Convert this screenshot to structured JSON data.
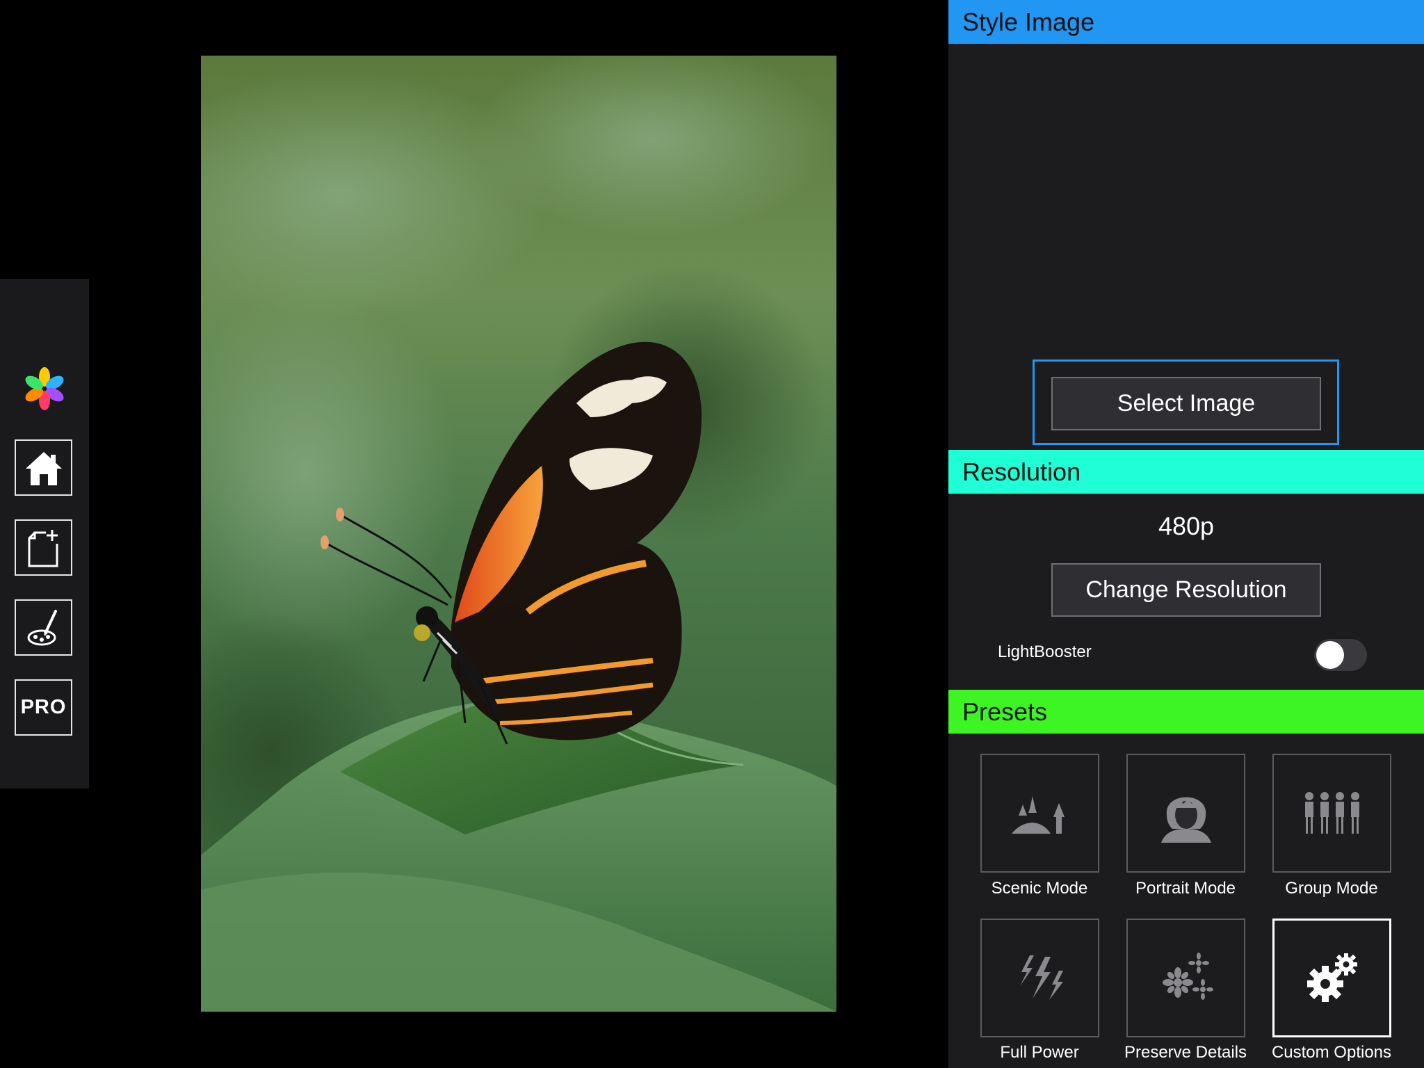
{
  "toolbar": {
    "items": [
      {
        "name": "app-logo-icon"
      },
      {
        "name": "home-icon"
      },
      {
        "name": "new-document-icon"
      },
      {
        "name": "paint-brush-icon"
      },
      {
        "name": "pro-badge",
        "label": "PRO"
      }
    ]
  },
  "photo": {
    "subject": "butterfly-on-leaf"
  },
  "style_image": {
    "title": "Style Image",
    "select_label": "Select Image"
  },
  "resolution": {
    "title": "Resolution",
    "value": "480p",
    "change_label": "Change Resolution",
    "lightbooster_label": "LightBooster",
    "lightbooster_on": false
  },
  "presets": {
    "title": "Presets",
    "items": [
      {
        "label": "Scenic Mode",
        "icon": "landscape-icon",
        "selected": false
      },
      {
        "label": "Portrait Mode",
        "icon": "portrait-icon",
        "selected": false
      },
      {
        "label": "Group Mode",
        "icon": "group-icon",
        "selected": false
      },
      {
        "label": "Full Power",
        "icon": "lightning-icon",
        "selected": false
      },
      {
        "label": "Preserve Details",
        "icon": "details-icon",
        "selected": false
      },
      {
        "label": "Custom Options",
        "icon": "gears-icon",
        "selected": true
      }
    ]
  },
  "colors": {
    "style_header": "#2196f3",
    "resolution_header": "#1effd6",
    "presets_header": "#3ef524",
    "panel_bg": "#1c1c1e"
  }
}
